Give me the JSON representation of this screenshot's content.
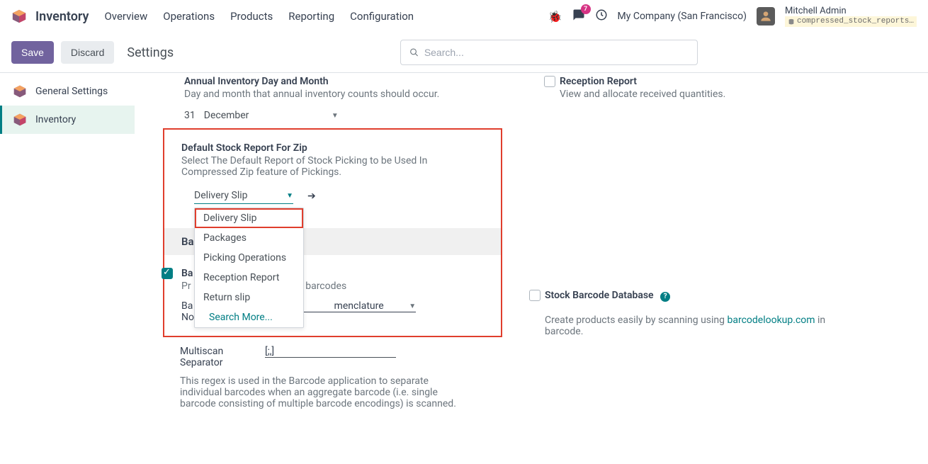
{
  "nav": {
    "brand": "Inventory",
    "items": [
      "Overview",
      "Operations",
      "Products",
      "Reporting",
      "Configuration"
    ],
    "company": "My Company (San Francisco)",
    "user_name": "Mitchell Admin",
    "user_db": "compressed_stock_reports…",
    "chat_badge": "7"
  },
  "bar": {
    "save": "Save",
    "discard": "Discard",
    "title": "Settings",
    "search_placeholder": "Search..."
  },
  "sidebar": {
    "items": [
      {
        "label": "General Settings"
      },
      {
        "label": "Inventory"
      }
    ]
  },
  "annual": {
    "title": "Annual Inventory Day and Month",
    "desc": "Day and month that annual inventory counts should occur.",
    "day": "31",
    "month": "December"
  },
  "reception": {
    "title": "Reception Report",
    "desc": "View and allocate received quantities."
  },
  "zip": {
    "title": "Default Stock Report For Zip",
    "desc": "Select The Default Report of Stock Picking to be Used In Compressed Zip feature of Pickings.",
    "selected": "Delivery Slip",
    "options": [
      "Delivery Slip",
      "Packages",
      "Picking Operations",
      "Reception Report",
      "Return slip"
    ],
    "search_more": "Search More..."
  },
  "barcode_section": "Barcode",
  "barcode_scanner": {
    "title_prefix": "Ba",
    "desc_prefix": "Pr",
    "desc_suffix": "th barcodes",
    "nom_label_prefix": "Ba",
    "nom_label_suffix": "Nomenclature",
    "nom_value_suffix": "menclature",
    "multiscan_label": "Multiscan Separator",
    "multiscan_value": "[;,]",
    "regex_help": "This regex is used in the Barcode application to separate individual barcodes when an aggregate barcode (i.e. single barcode consisting of multiple barcode encodings) is scanned."
  },
  "barcode_db": {
    "title": "Stock Barcode Database",
    "desc_before": "Create products easily by scanning using ",
    "link": "barcodelookup.com",
    "desc_after": " in barcode."
  }
}
